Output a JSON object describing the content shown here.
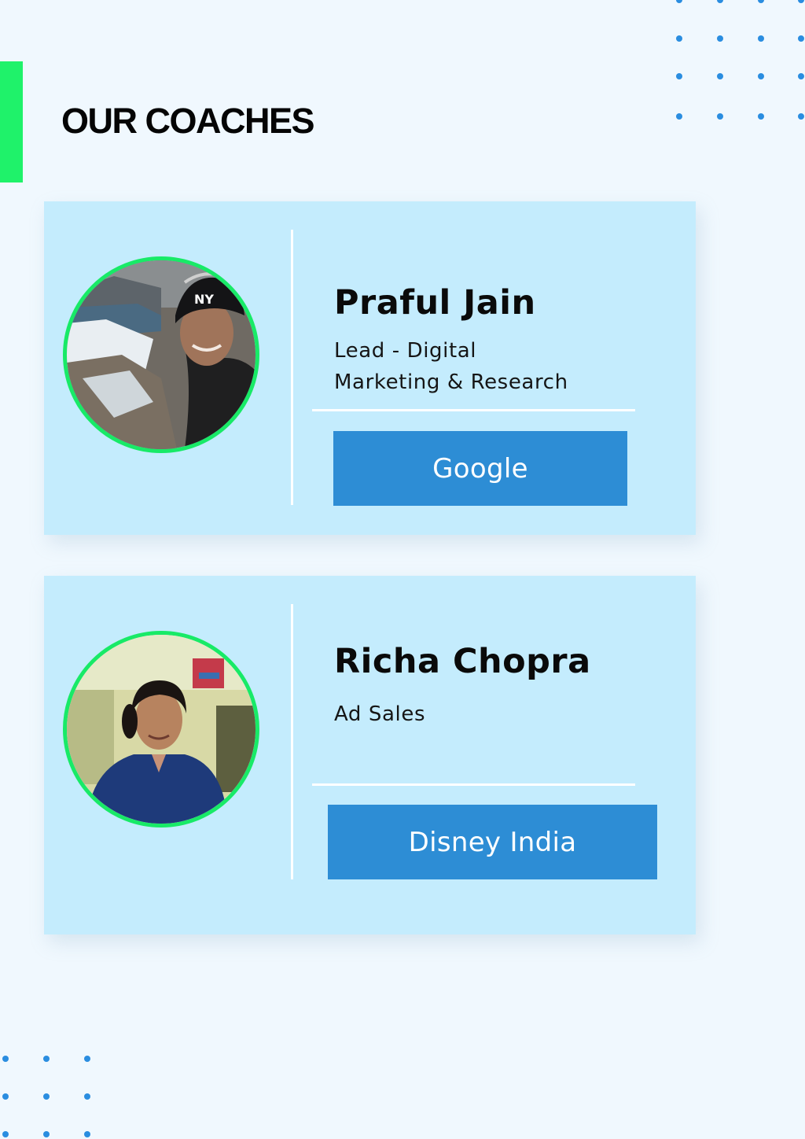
{
  "page": {
    "title": "OUR COACHES"
  },
  "colors": {
    "background": "#f0f8fe",
    "accent": "#1ff26a",
    "card": "#c4ecfd",
    "button": "#2d8dd5",
    "dots": "#2a8de0"
  },
  "coaches": [
    {
      "name": "Praful Jain",
      "role_lines": [
        "Lead - Digital",
        "Marketing & Research"
      ],
      "company": "Google"
    },
    {
      "name": "Richa Chopra",
      "role_lines": [
        "Ad Sales"
      ],
      "company": "Disney India"
    }
  ]
}
